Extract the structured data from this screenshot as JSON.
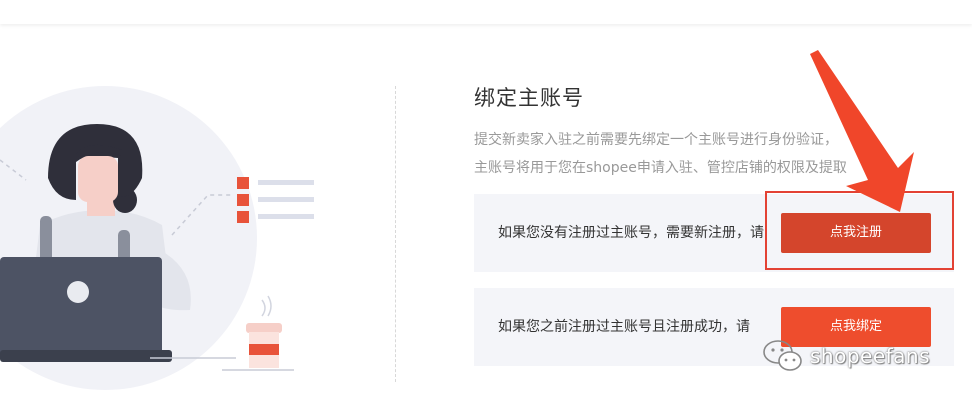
{
  "page": {
    "title": "绑定主账号",
    "description_lines": [
      "提交新卖家入驻之前需要先绑定一个主账号进行身份验证，",
      "主账号将用于您在shopee申请入驻、管控店铺的权限及提取"
    ]
  },
  "register_card": {
    "text": "如果您没有注册过主账号，需要新注册，请",
    "button_label": "点我注册"
  },
  "bind_card": {
    "text": "如果您之前注册过主账号且注册成功，请",
    "button_label": "点我绑定"
  },
  "watermark": {
    "icon": "wechat-icon",
    "text": "shopeefans"
  },
  "colors": {
    "register_button": "#d4452c",
    "bind_button": "#ee4d2d",
    "annotation": "#e34234",
    "card_background": "#f4f5f9"
  }
}
